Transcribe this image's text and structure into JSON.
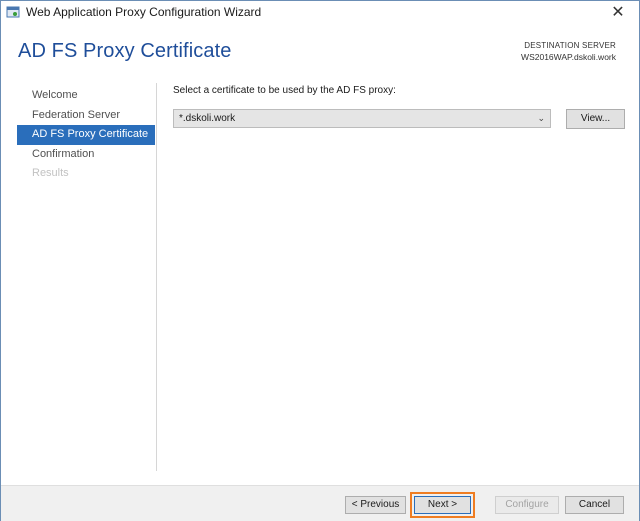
{
  "window": {
    "title": "Web Application Proxy Configuration Wizard"
  },
  "header": {
    "page_title": "AD FS Proxy Certificate",
    "destination_label": "DESTINATION SERVER",
    "destination_server": "WS2016WAP.dskoli.work"
  },
  "sidebar": {
    "items": [
      {
        "label": "Welcome",
        "state": "normal"
      },
      {
        "label": "Federation Server",
        "state": "normal"
      },
      {
        "label": "AD FS Proxy Certificate",
        "state": "active"
      },
      {
        "label": "Confirmation",
        "state": "normal"
      },
      {
        "label": "Results",
        "state": "disabled"
      }
    ]
  },
  "main": {
    "prompt": "Select a certificate to be used by the AD FS proxy:",
    "certificate_selected": "*.dskoli.work",
    "view_label": "View..."
  },
  "footer": {
    "previous_label": "< Previous",
    "next_label": "Next >",
    "configure_label": "Configure",
    "cancel_label": "Cancel"
  },
  "colors": {
    "accent": "#2a6ebb",
    "title": "#1f4e9a",
    "highlight": "#ef7d22"
  },
  "icons": {
    "app": "proxy-wizard-icon",
    "close": "close-icon",
    "dropdown": "chevron-down-icon"
  }
}
